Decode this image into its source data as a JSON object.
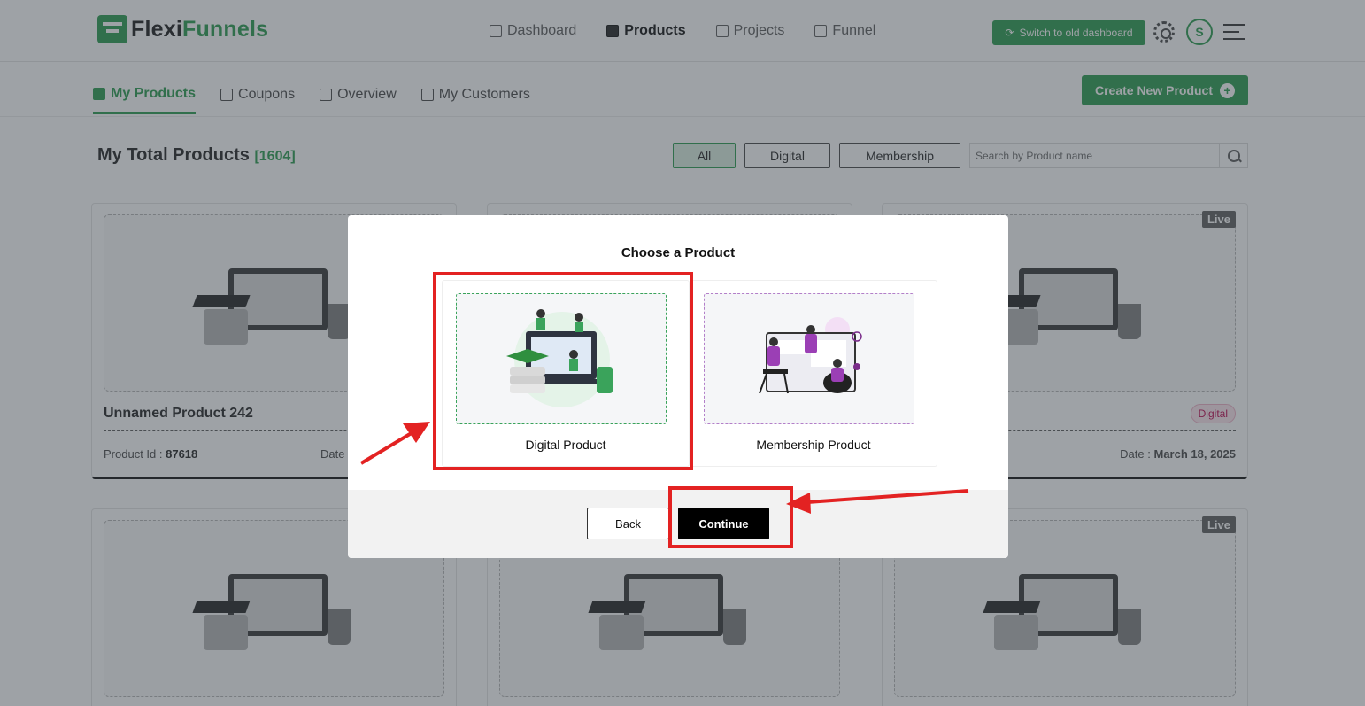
{
  "app": {
    "logo_prefix": "Flexi",
    "logo_suffix": "Funnels"
  },
  "nav": {
    "items": [
      {
        "label": "Dashboard",
        "icon": "dashboard-icon"
      },
      {
        "label": "Products",
        "icon": "products-icon",
        "active": true
      },
      {
        "label": "Projects",
        "icon": "projects-icon"
      },
      {
        "label": "Funnel",
        "icon": "funnel-icon"
      }
    ],
    "switch_label": "Switch to old dashboard",
    "avatar_initial": "S"
  },
  "subnav": {
    "tabs": [
      {
        "label": "My Products",
        "active": true
      },
      {
        "label": "Coupons"
      },
      {
        "label": "Overview"
      },
      {
        "label": "My Customers"
      }
    ],
    "create_label": "Create New Product"
  },
  "page": {
    "title": "My Total Products",
    "count": "[1604]",
    "filters": [
      "All",
      "Digital",
      "Membership"
    ],
    "search_placeholder": "Search by Product name"
  },
  "cards": [
    {
      "name": "Unnamed Product 242",
      "id_label": "Product Id :",
      "id": "87618",
      "date_label": "Date"
    },
    {
      "live": "Live",
      "badge": "Digital",
      "date_label": "Date :",
      "date": "March 18, 2025"
    },
    {
      "live": "Live"
    }
  ],
  "modal": {
    "title": "Choose a Product",
    "options": [
      {
        "label": "Digital Product"
      },
      {
        "label": "Membership Product"
      }
    ],
    "back_label": "Back",
    "continue_label": "Continue"
  },
  "colors": {
    "brand_green": "#3aa35b",
    "annotation_red": "#e32222",
    "membership_purple": "#b37fc9"
  }
}
